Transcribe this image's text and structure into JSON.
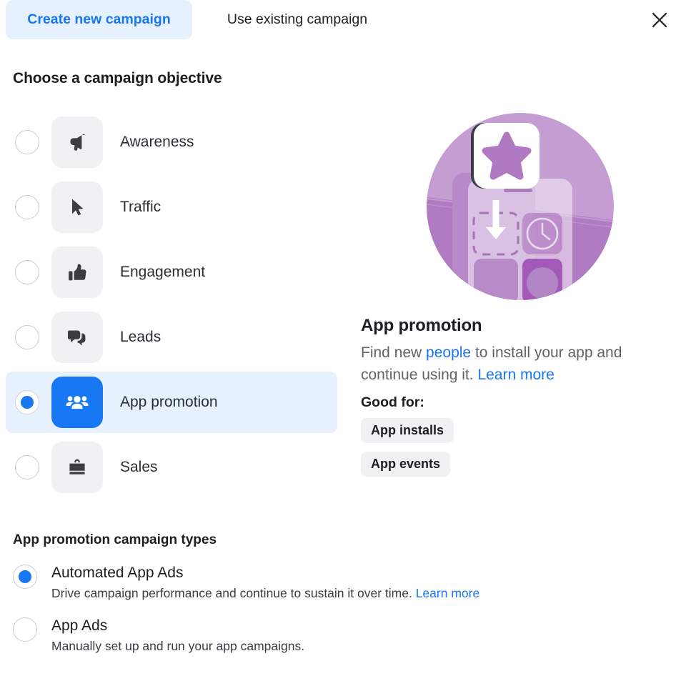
{
  "header": {
    "tabs": [
      {
        "label": "Create new campaign",
        "active": true
      },
      {
        "label": "Use existing campaign",
        "active": false
      }
    ],
    "close_icon": "close-icon"
  },
  "objective_section": {
    "title": "Choose a campaign objective",
    "options": [
      {
        "label": "Awareness",
        "icon": "megaphone-icon",
        "selected": false
      },
      {
        "label": "Traffic",
        "icon": "cursor-arrow-icon",
        "selected": false
      },
      {
        "label": "Engagement",
        "icon": "thumbs-up-icon",
        "selected": false
      },
      {
        "label": "Leads",
        "icon": "speech-bubbles-icon",
        "selected": false
      },
      {
        "label": "App promotion",
        "icon": "people-group-icon",
        "selected": true
      },
      {
        "label": "Sales",
        "icon": "shopping-bag-icon",
        "selected": false
      }
    ]
  },
  "detail": {
    "illustration": "app-promotion-illustration",
    "title": "App promotion",
    "description_part1": "Find new ",
    "description_link1": "people",
    "description_part2": " to install your app and continue using it. ",
    "description_link2": "Learn more",
    "good_for_label": "Good for:",
    "badges": [
      "App installs",
      "App events"
    ]
  },
  "campaign_types": {
    "title": "App promotion campaign types",
    "options": [
      {
        "label": "Automated App Ads",
        "description": "Drive campaign performance and continue to sustain it over time. ",
        "description_link": "Learn more",
        "selected": true
      },
      {
        "label": "App Ads",
        "description": "Manually set up and run your app campaigns.",
        "description_link": "",
        "selected": false
      }
    ]
  },
  "colors": {
    "accent_blue": "#1877f2",
    "selected_row_bg": "#e7f0fd",
    "tab_active_bg": "#e7f1fe",
    "tile_bg": "#f0f1f3",
    "text_primary": "#1c1e21",
    "text_secondary": "#606367",
    "illustration_purple": "#b98ec6"
  }
}
